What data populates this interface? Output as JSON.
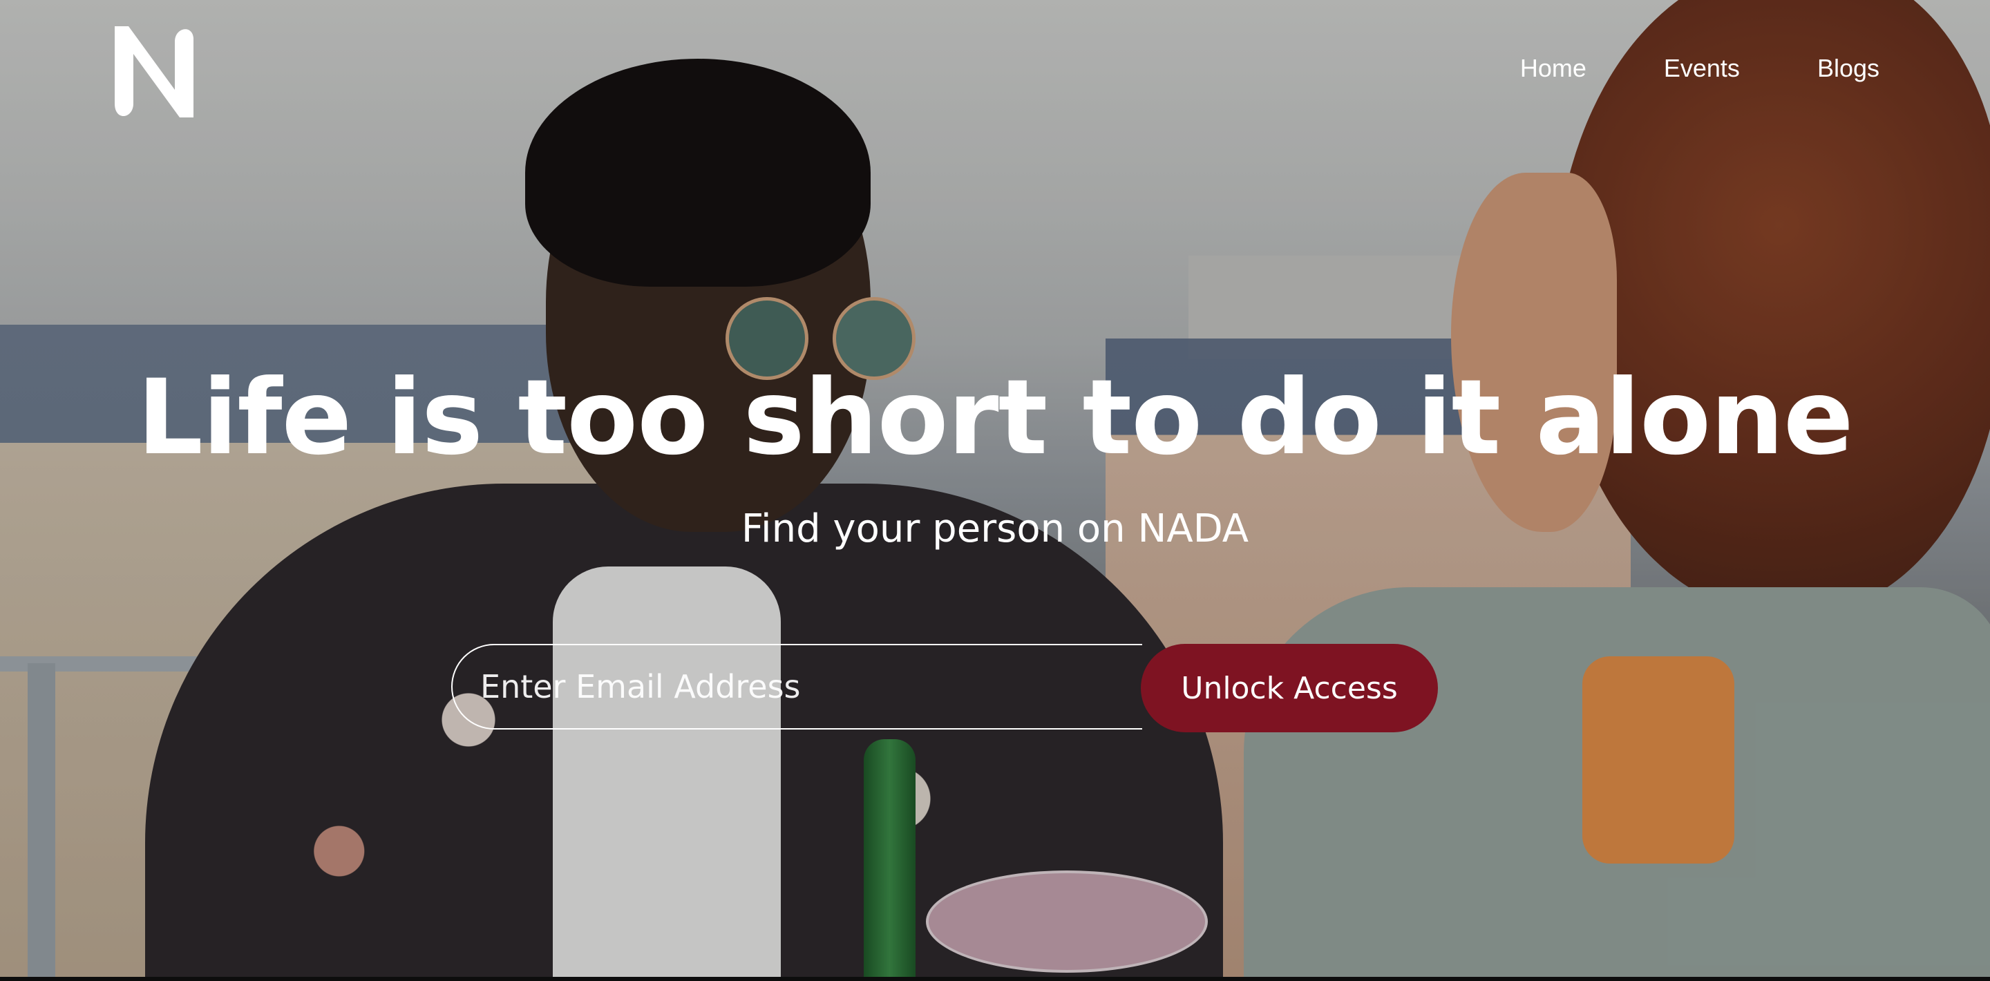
{
  "brand": {
    "logo_letter": "N"
  },
  "nav": {
    "items": [
      {
        "label": "Home"
      },
      {
        "label": "Events"
      },
      {
        "label": "Blogs"
      }
    ]
  },
  "hero": {
    "headline": "Life is too short to do it alone",
    "subheadline": "Find your person on NADA",
    "email_placeholder": "Enter Email Address",
    "cta_label": "Unlock Access"
  },
  "colors": {
    "cta_background": "#7e1322",
    "text": "#ffffff"
  }
}
